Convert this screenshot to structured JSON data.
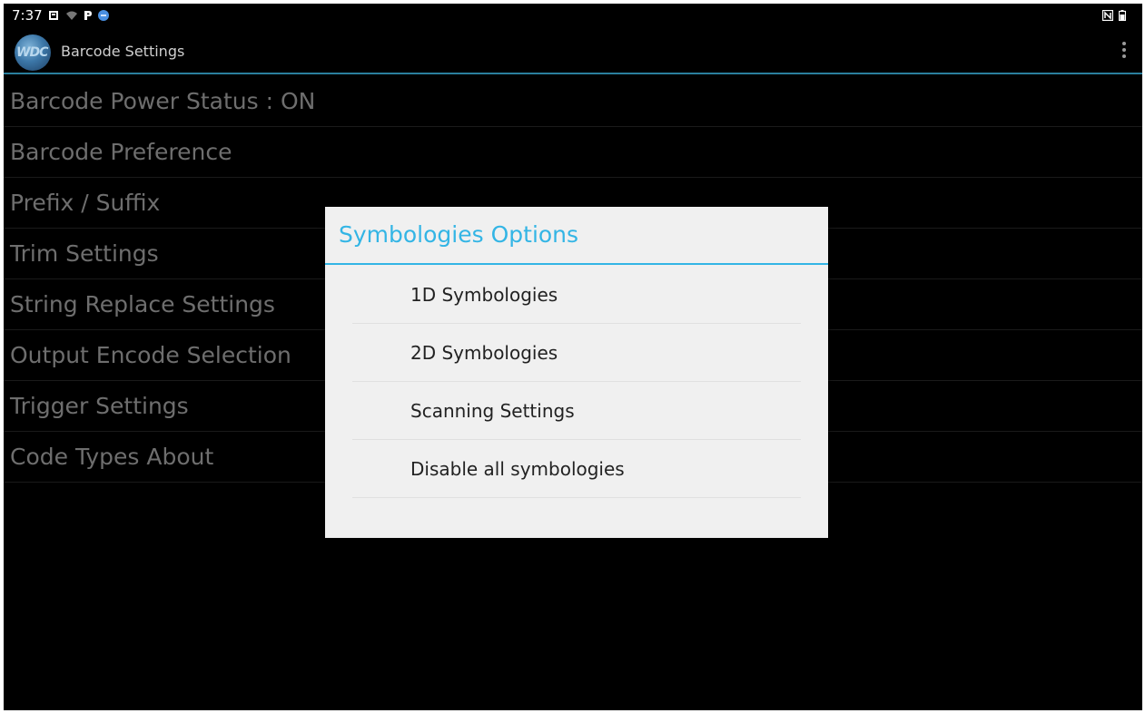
{
  "status_bar": {
    "time": "7:37",
    "left_icons": [
      "notification-icon",
      "wifi-icon",
      "parking-icon",
      "app-badge-icon"
    ],
    "right_icons": [
      "nfc-icon",
      "battery-icon"
    ]
  },
  "action_bar": {
    "logo_text": "WDC",
    "title": "Barcode Settings",
    "menu_icon": "overflow-menu-icon"
  },
  "settings_list": {
    "items": [
      {
        "label": "Barcode Power Status : ON"
      },
      {
        "label": "Barcode Preference"
      },
      {
        "label": "Prefix / Suffix"
      },
      {
        "label": "Trim Settings"
      },
      {
        "label": "String Replace Settings"
      },
      {
        "label": "Output Encode Selection"
      },
      {
        "label": "Trigger Settings"
      },
      {
        "label": "Code Types About"
      }
    ]
  },
  "dialog": {
    "title": "Symbologies Options",
    "options": [
      {
        "label": "1D Symbologies"
      },
      {
        "label": "2D Symbologies"
      },
      {
        "label": "Scanning Settings"
      },
      {
        "label": "Disable all symbologies"
      }
    ]
  },
  "colors": {
    "background": "#000000",
    "accent": "#33b5e5",
    "dialog_background": "#f0f0f0",
    "list_text": "#6e6e6e"
  }
}
